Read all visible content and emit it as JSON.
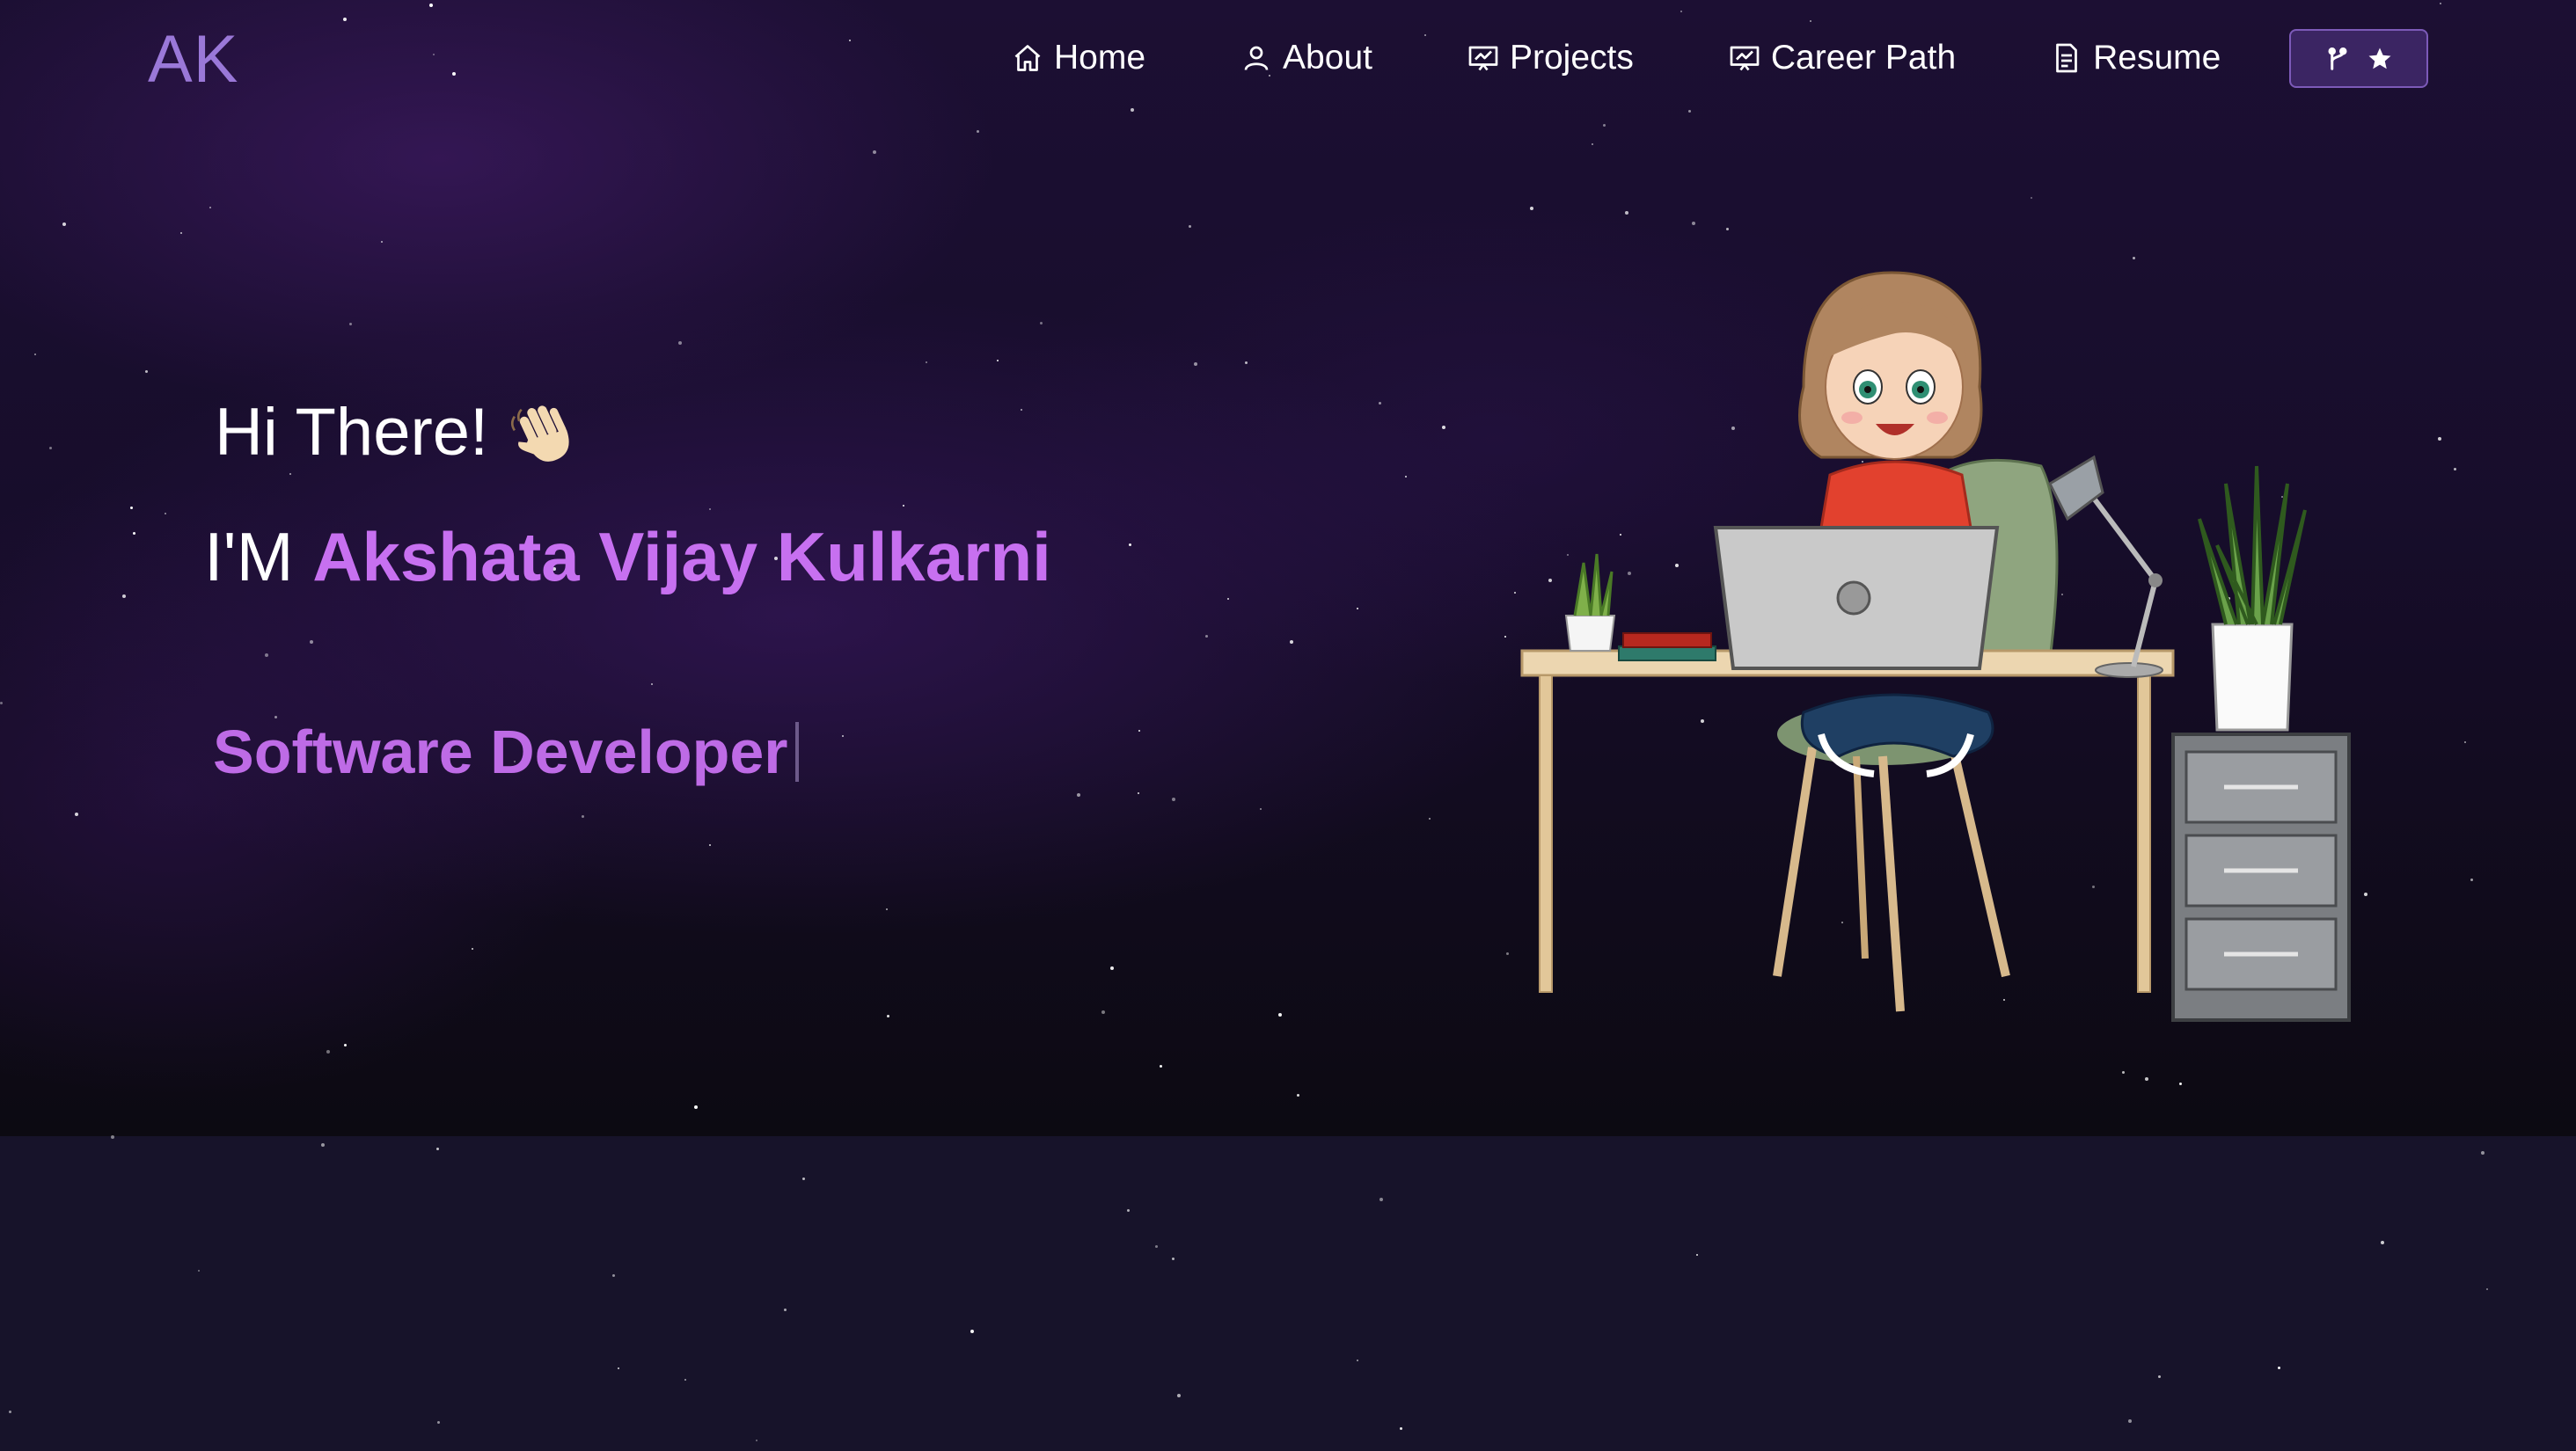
{
  "logo": "AK",
  "nav": {
    "items": [
      {
        "label": "Home",
        "icon": "home-icon"
      },
      {
        "label": "About",
        "icon": "user-icon"
      },
      {
        "label": "Projects",
        "icon": "presentation-icon"
      },
      {
        "label": "Career Path",
        "icon": "presentation-icon"
      },
      {
        "label": "Resume",
        "icon": "document-icon"
      }
    ],
    "github_button": {
      "icons": [
        "fork-icon",
        "star-icon"
      ]
    }
  },
  "hero": {
    "greeting": "Hi There!",
    "greeting_emoji": "waving-hand",
    "name_prefix": "I'M",
    "name": "Akshata Vijay Kulkarni",
    "role": "Software Developer"
  },
  "colors": {
    "accent": "#c770f0",
    "logo": "#9a78d8",
    "button_bg": "#3b2563",
    "background": "#1c0f33"
  }
}
